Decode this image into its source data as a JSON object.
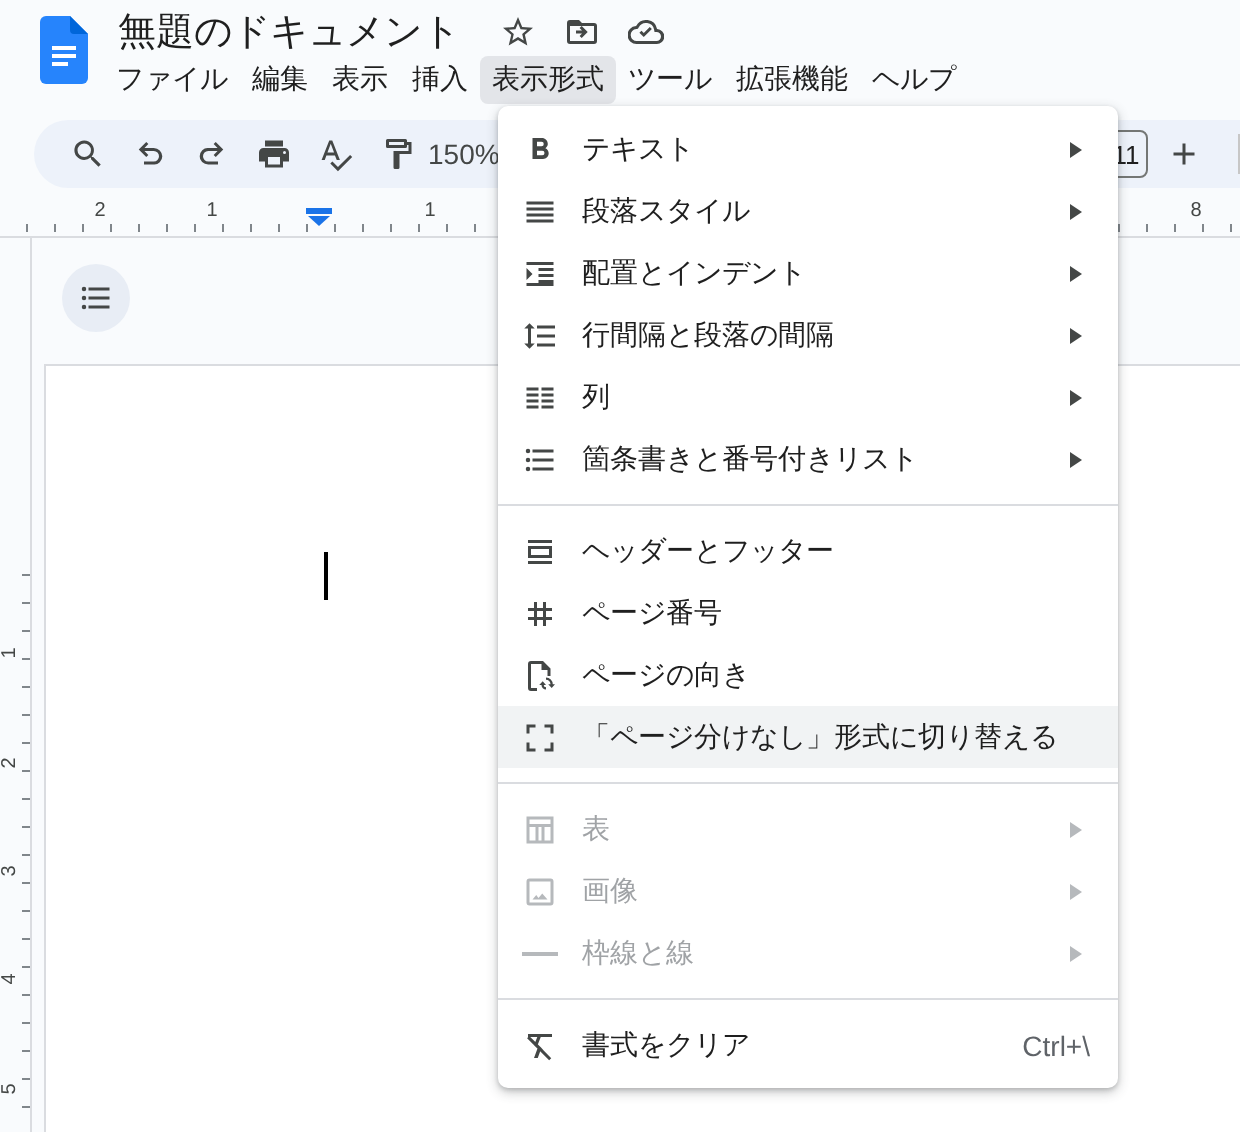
{
  "document": {
    "title": "無題のドキュメント"
  },
  "menubar": [
    {
      "label": "ファイル",
      "selected": false
    },
    {
      "label": "編集",
      "selected": false
    },
    {
      "label": "表示",
      "selected": false
    },
    {
      "label": "挿入",
      "selected": false
    },
    {
      "label": "表示形式",
      "selected": true
    },
    {
      "label": "ツール",
      "selected": false
    },
    {
      "label": "拡張機能",
      "selected": false
    },
    {
      "label": "ヘルプ",
      "selected": false
    }
  ],
  "toolbar": {
    "zoom": "150%",
    "font_size": "11"
  },
  "top_ruler": [
    "2",
    "1",
    "1",
    "8"
  ],
  "left_ruler": [
    "1",
    "2",
    "3",
    "4",
    "5"
  ],
  "format_menu": [
    [
      {
        "kind": "submenu",
        "label": "テキスト",
        "disabled": false,
        "highlighted": false
      },
      {
        "kind": "submenu",
        "label": "段落スタイル",
        "disabled": false,
        "highlighted": false
      },
      {
        "kind": "submenu",
        "label": "配置とインデント",
        "disabled": false,
        "highlighted": false
      },
      {
        "kind": "submenu",
        "label": "行間隔と段落の間隔",
        "disabled": false,
        "highlighted": false
      },
      {
        "kind": "submenu",
        "label": "列",
        "disabled": false,
        "highlighted": false
      },
      {
        "kind": "submenu",
        "label": "箇条書きと番号付きリスト",
        "disabled": false,
        "highlighted": false
      }
    ],
    [
      {
        "kind": "action",
        "label": "ヘッダーとフッター",
        "disabled": false,
        "highlighted": false
      },
      {
        "kind": "action",
        "label": "ページ番号",
        "disabled": false,
        "highlighted": false
      },
      {
        "kind": "action",
        "label": "ページの向き",
        "disabled": false,
        "highlighted": false
      },
      {
        "kind": "action",
        "label": "「ページ分けなし」形式に切り替える",
        "disabled": false,
        "highlighted": true
      }
    ],
    [
      {
        "kind": "submenu",
        "label": "表",
        "disabled": true,
        "highlighted": false
      },
      {
        "kind": "submenu",
        "label": "画像",
        "disabled": true,
        "highlighted": false
      },
      {
        "kind": "submenu",
        "label": "枠線と線",
        "disabled": true,
        "highlighted": false
      }
    ],
    [
      {
        "kind": "action",
        "label": "書式をクリア",
        "shortcut": "Ctrl+\\",
        "disabled": false,
        "highlighted": false
      }
    ]
  ]
}
